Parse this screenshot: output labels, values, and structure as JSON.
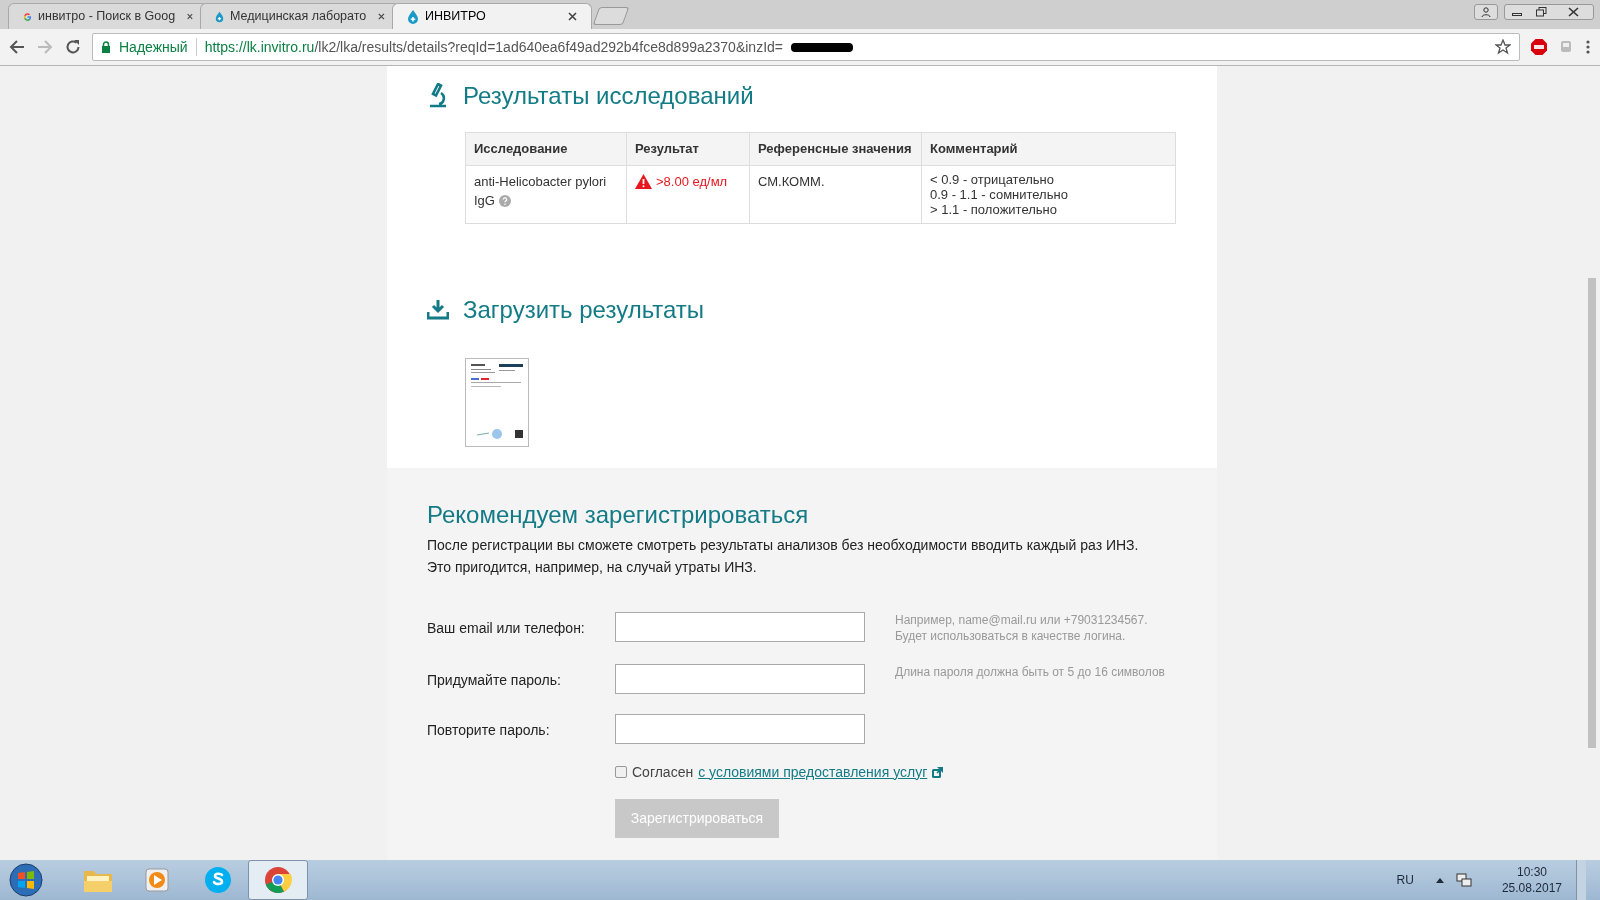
{
  "browser": {
    "tabs": [
      {
        "title": "инвитро - Поиск в Goog",
        "kind": "google",
        "selected": false
      },
      {
        "title": "Медицинская лаборато",
        "kind": "drop",
        "selected": false
      },
      {
        "title": "ИНВИТРО",
        "kind": "drop",
        "selected": true
      }
    ],
    "address_bar": {
      "security_label": "Надежный",
      "url_host": "https://lk.invitro.ru",
      "url_path": "/lk2/lka/results/details?reqId=1ad640ea6f49ad292b4fce8d899a2370&inzId=",
      "redacted": true
    }
  },
  "results_section": {
    "title": "Результаты исследований",
    "table": {
      "columns": [
        "Исследование",
        "Результат",
        "Референсные значения",
        "Комментарий"
      ],
      "rows": [
        {
          "test": "anti-Helicobacter pylori IgG",
          "result": ">8.00 ед/мл",
          "flagged": true,
          "reference": "СМ.КОММ.",
          "comment": [
            "< 0.9 - отрицательно",
            "0.9 - 1.1 - сомнительно",
            "> 1.1 - положительно"
          ]
        }
      ]
    }
  },
  "download_section": {
    "title": "Загрузить результаты"
  },
  "register_section": {
    "title": "Рекомендуем зарегистрироваться",
    "paragraphs": [
      "После регистрации вы сможете смотреть результаты анализов без необходимости вводить каждый раз ИНЗ.",
      "Это пригодится, например, на случай утраты ИНЗ."
    ],
    "fields": [
      {
        "label": "Ваш email или телефон:",
        "hint": [
          "Например, name@mail.ru или +79031234567.",
          "Будет использоваться в качестве логина."
        ]
      },
      {
        "label": "Придумайте пароль:",
        "hint": [
          "Длина пароля должна быть от 5 до 16 символов"
        ]
      },
      {
        "label": "Повторите пароль:"
      }
    ],
    "agreement": {
      "label": "Согласен",
      "link": "с условиями предоставления услуг",
      "checked": false
    },
    "button": {
      "label": "Зарегистрироваться",
      "disabled": true
    }
  },
  "taskbar": {
    "apps": [
      {
        "kind": "folder",
        "selected": false
      },
      {
        "kind": "media",
        "selected": false
      },
      {
        "kind": "skype",
        "selected": false
      },
      {
        "kind": "chrome",
        "selected": true
      }
    ],
    "language": "RU",
    "time": "10:30",
    "date": "25.08.2017"
  }
}
